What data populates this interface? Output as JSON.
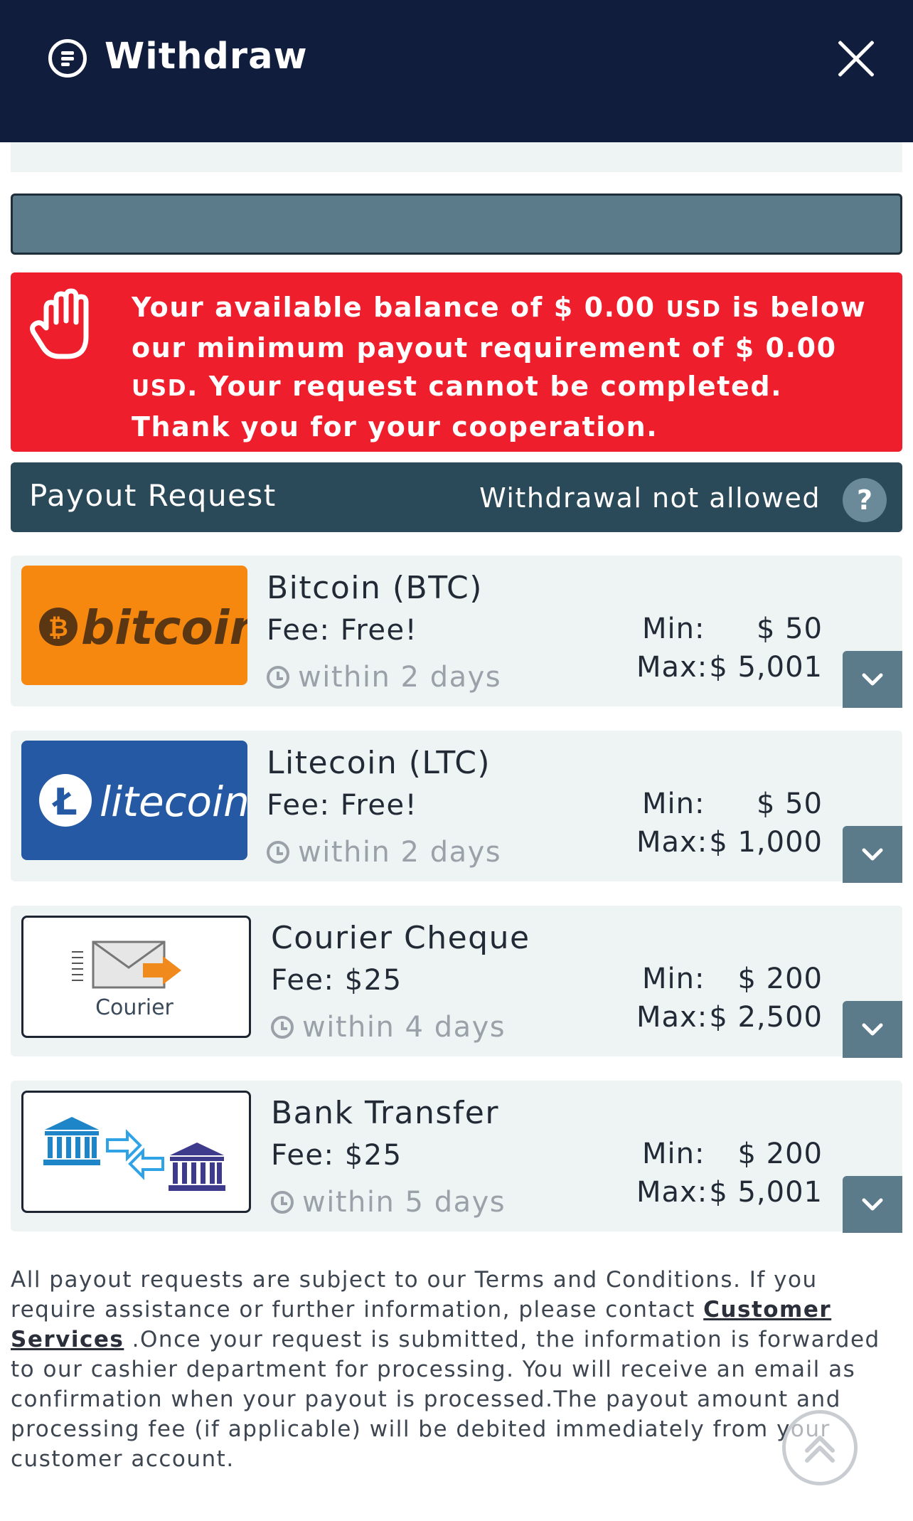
{
  "header": {
    "title": "Withdraw"
  },
  "alert": {
    "text_1": "Your available balance of $ 0.00 ",
    "currency_1": "USD",
    "text_2": " is below our minimum payout requirement of $ 0.00 ",
    "currency_2": "USD",
    "text_3": ". Your request cannot be completed. Thank you for your cooperation."
  },
  "payout": {
    "title": "Payout Request",
    "status": "Withdrawal not allowed",
    "help": "?"
  },
  "methods": [
    {
      "name": "Bitcoin (BTC)",
      "fee": "Fee: Free!",
      "time": "within 2 days",
      "min_label": "Min:",
      "min": "$ 50",
      "max_label": "Max:",
      "max": "$ 5,001",
      "logo_text": "bitcoin"
    },
    {
      "name": "Litecoin (LTC)",
      "fee": "Fee: Free!",
      "time": "within 2 days",
      "min_label": "Min:",
      "min": "$ 50",
      "max_label": "Max:",
      "max": "$ 1,000",
      "logo_text": "litecoin"
    },
    {
      "name": "Courier Cheque",
      "fee": "Fee: $25",
      "time": "within 4 days",
      "min_label": "Min:",
      "min": "$ 200",
      "max_label": "Max:",
      "max": "$ 2,500",
      "logo_text": "Courier"
    },
    {
      "name": "Bank Transfer",
      "fee": "Fee: $25",
      "time": "within 5 days",
      "min_label": "Min:",
      "min": "$ 200",
      "max_label": "Max:",
      "max": "$ 5,001"
    }
  ],
  "footer": {
    "text_before": "All payout requests are subject to our Terms and Conditions. If you require assistance or further information, please contact ",
    "link": "Customer Services",
    "text_after": " .Once your request is submitted, the information is forwarded to our cashier department for processing. You will receive an email as confirmation when your payout is processed.The payout amount and processing fee (if applicable) will be debited immediately from your customer account."
  },
  "colors": {
    "header": "#111d3d",
    "alert": "#ee1e2d",
    "payout_header": "#2a4959",
    "bitcoin": "#f7880f",
    "litecoin": "#2559a3"
  }
}
